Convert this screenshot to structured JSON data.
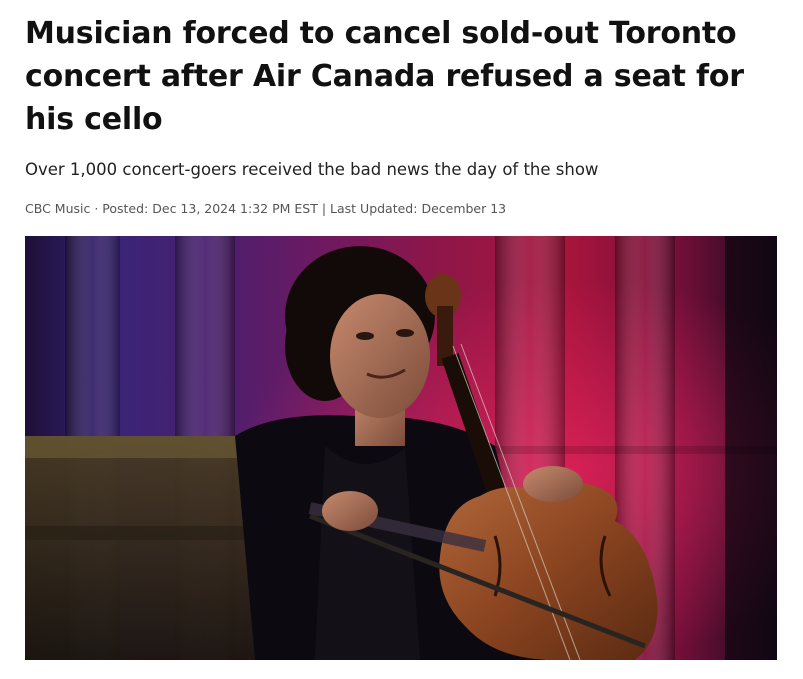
{
  "article": {
    "headline": "Musician forced to cancel sold-out Toronto concert after Air Canada refused a seat for his cello",
    "deck": "Over 1,000 concert-goers received the bad news the day of the show",
    "byline": {
      "source": "CBC Music",
      "separator_dot": " · ",
      "posted_label": "Posted: ",
      "posted_value": "Dec 13, 2024 1:32 PM EST",
      "separator_bar": " | ",
      "updated_label": "Last Updated: ",
      "updated_value": "December 13"
    },
    "photo": {
      "icon": "lead-photo-cellist"
    }
  }
}
